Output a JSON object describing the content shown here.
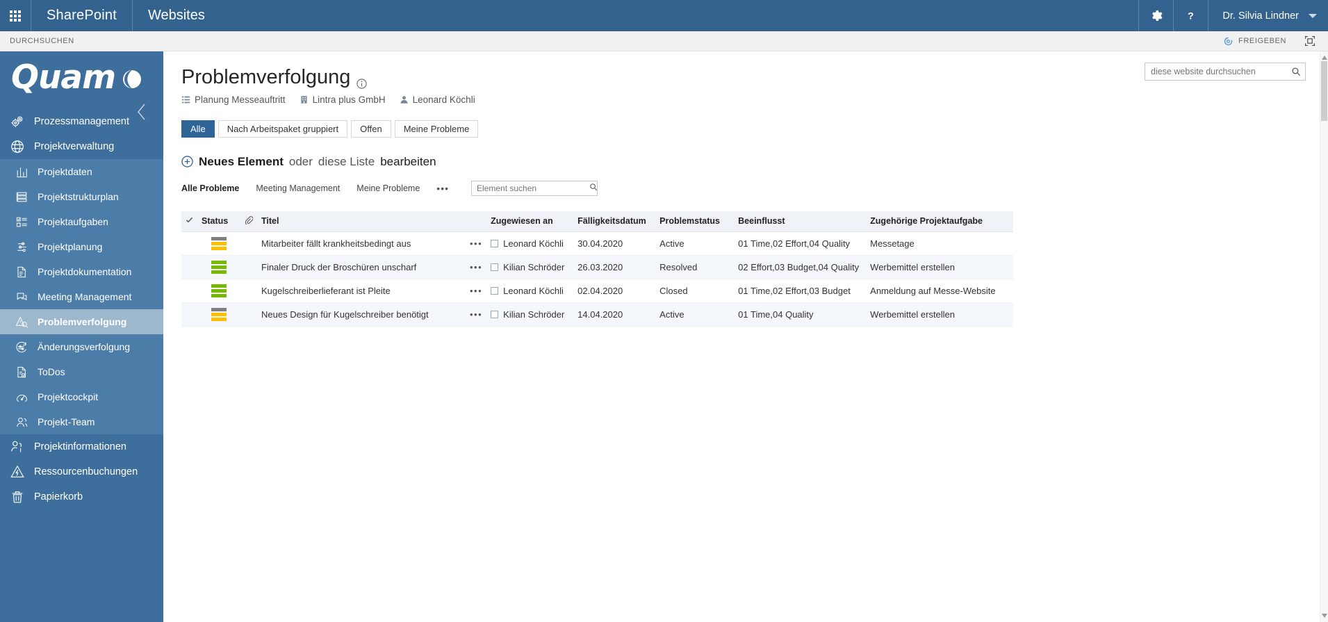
{
  "suitebar": {
    "waffle_label": "App-Startfeld",
    "brand": "SharePoint",
    "site": "Websites",
    "settings_title": "Einstellungen",
    "help_title": "Hilfe",
    "user": "Dr. Silvia Lindner"
  },
  "ribbon": {
    "tab": "DURCHSUCHEN",
    "share": "FREIGEBEN",
    "focus_title": "Auf Inhalt fokussieren"
  },
  "sidebar": {
    "logo": "Quam",
    "collapse_title": "Navigation einklappen",
    "items": [
      {
        "label": "Prozessmanagement",
        "icon": "gears-icon",
        "level": "top",
        "active": false
      },
      {
        "label": "Projektverwaltung",
        "icon": "globe-icon",
        "level": "top",
        "active": false
      },
      {
        "label": "Projektdaten",
        "icon": "bar-chart-icon",
        "level": "sub",
        "active": false
      },
      {
        "label": "Projektstrukturplan",
        "icon": "structure-icon",
        "level": "sub",
        "active": false
      },
      {
        "label": "Projektaufgaben",
        "icon": "tasklist-icon",
        "level": "sub",
        "active": false
      },
      {
        "label": "Projektplanung",
        "icon": "gantt-icon",
        "level": "sub",
        "active": false
      },
      {
        "label": "Projektdokumentation",
        "icon": "document-icon",
        "level": "sub",
        "active": false
      },
      {
        "label": "Meeting Management",
        "icon": "chat-icon",
        "level": "sub",
        "active": false
      },
      {
        "label": "Problemverfolgung",
        "icon": "warning-search-icon",
        "level": "sub",
        "active": true
      },
      {
        "label": "Änderungsverfolgung",
        "icon": "change-icon",
        "level": "sub",
        "active": false
      },
      {
        "label": "ToDos",
        "icon": "checklist-icon",
        "level": "sub",
        "active": false
      },
      {
        "label": "Projektcockpit",
        "icon": "gauge-icon",
        "level": "sub",
        "active": false
      },
      {
        "label": "Projekt-Team",
        "icon": "people-icon",
        "level": "sub",
        "active": false
      },
      {
        "label": "Projektinformationen",
        "icon": "person-info-icon",
        "level": "top",
        "active": false
      },
      {
        "label": "Ressourcenbuchungen",
        "icon": "bolt-warning-icon",
        "level": "top",
        "active": false
      },
      {
        "label": "Papierkorb",
        "icon": "trash-icon",
        "level": "top",
        "active": false
      }
    ]
  },
  "site_search": {
    "placeholder": "diese website durchsuchen",
    "value": "",
    "icon": "search-icon"
  },
  "page": {
    "title": "Problemverfolgung",
    "info_title": "Informationen",
    "breadcrumb": [
      {
        "label": "Planung Messeauftritt",
        "icon": "list-icon"
      },
      {
        "label": "Lintra plus GmbH",
        "icon": "building-icon"
      },
      {
        "label": "Leonard Köchli",
        "icon": "person-icon"
      }
    ],
    "view_tabs": [
      {
        "label": "Alle",
        "active": true
      },
      {
        "label": "Nach Arbeitspaket gruppiert",
        "active": false
      },
      {
        "label": "Offen",
        "active": false
      },
      {
        "label": "Meine Probleme",
        "active": false
      }
    ],
    "new_item": {
      "plus_icon": "plus-circle-icon",
      "strong": "Neues Element",
      "middle": " oder ",
      "link": "diese Liste",
      "tail": " bearbeiten"
    },
    "filters": [
      {
        "label": "Alle Probleme",
        "active": true
      },
      {
        "label": "Meeting Management",
        "active": false
      },
      {
        "label": "Meine Probleme",
        "active": false
      }
    ],
    "filter_more": "•••",
    "list_search": {
      "placeholder": "Element suchen",
      "value": "",
      "icon": "search-icon"
    }
  },
  "table": {
    "headers": {
      "check": "",
      "status": "Status",
      "clip": "",
      "title": "Titel",
      "assigned": "Zugewiesen an",
      "due": "Fälligkeitsdatum",
      "pstatus": "Problemstatus",
      "influenced": "Beeinflusst",
      "task": "Zugehörige Projektaufgabe"
    },
    "row_menu": "•••",
    "rows": [
      {
        "status_icon": "priority-medium-icon",
        "status_colors": [
          "#7f7f7f",
          "#ffc000",
          "#ffc000"
        ],
        "title": "Mitarbeiter fällt krankheitsbedingt aus",
        "assigned": "Leonard Köchli",
        "due": "30.04.2020",
        "pstatus": "Active",
        "influenced": "01 Time,02 Effort,04 Quality",
        "task": "Messetage"
      },
      {
        "status_icon": "priority-low-icon",
        "status_colors": [
          "#76b900",
          "#76b900",
          "#76b900"
        ],
        "title": "Finaler Druck der Broschüren unscharf",
        "assigned": "Kilian Schröder",
        "due": "26.03.2020",
        "pstatus": "Resolved",
        "influenced": "02 Effort,03 Budget,04 Quality",
        "task": "Werbemittel erstellen"
      },
      {
        "status_icon": "priority-low-icon",
        "status_colors": [
          "#76b900",
          "#76b900",
          "#76b900"
        ],
        "title": "Kugelschreiberlieferant ist Pleite",
        "assigned": "Leonard Köchli",
        "due": "02.04.2020",
        "pstatus": "Closed",
        "influenced": "01 Time,02 Effort,03 Budget",
        "task": "Anmeldung auf Messe-Website"
      },
      {
        "status_icon": "priority-medium-icon",
        "status_colors": [
          "#7f7f7f",
          "#ffc000",
          "#ffc000"
        ],
        "title": "Neues Design für Kugelschreiber benötigt",
        "assigned": "Kilian Schröder",
        "due": "14.04.2020",
        "pstatus": "Active",
        "influenced": "01 Time,04 Quality",
        "task": "Werbemittel erstellen"
      }
    ]
  },
  "colors": {
    "suitebar": "#33628f",
    "sidebar": "#3e6e9b",
    "sidebar_sub": "#4c7da9",
    "sidebar_active": "#9db8cd",
    "accent": "#2f6497",
    "status_green": "#76b900",
    "status_amber": "#ffc000",
    "status_gray": "#7f7f7f"
  }
}
